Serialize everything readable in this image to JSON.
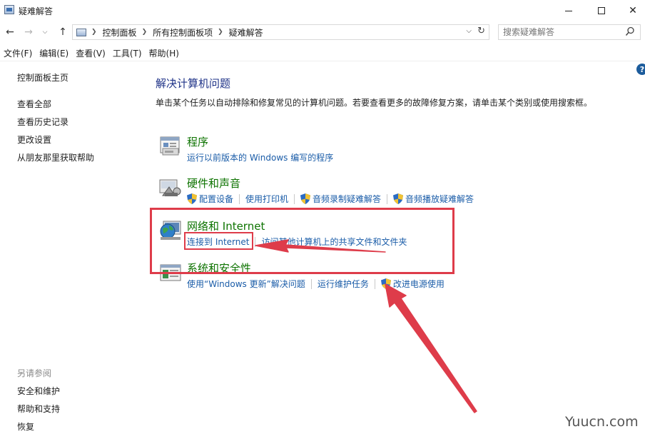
{
  "window": {
    "title": "疑难解答"
  },
  "address": {
    "crumbs": [
      "控制面板",
      "所有控制面板项",
      "疑难解答"
    ],
    "search_placeholder": "搜索疑难解答"
  },
  "menu": [
    "文件(F)",
    "编辑(E)",
    "查看(V)",
    "工具(T)",
    "帮助(H)"
  ],
  "sidebar": {
    "home": "控制面板主页",
    "links": [
      "查看全部",
      "查看历史记录",
      "更改设置",
      "从朋友那里获取帮助"
    ],
    "see_also_title": "另请参阅",
    "see_also": [
      "安全和维护",
      "帮助和支持",
      "恢复"
    ]
  },
  "main": {
    "title": "解决计算机问题",
    "description": "单击某个任务以自动排除和修复常见的计算机问题。若要查看更多的故障修复方案，请单击某个类别或使用搜索框。",
    "categories": [
      {
        "title": "程序",
        "icon": "programs-icon",
        "links": [
          {
            "label": "运行以前版本的 Windows 编写的程序",
            "shield": false
          }
        ]
      },
      {
        "title": "硬件和声音",
        "icon": "hardware-sound-icon",
        "links": [
          {
            "label": "配置设备",
            "shield": true
          },
          {
            "label": "使用打印机",
            "shield": false
          },
          {
            "label": "音频录制疑难解答",
            "shield": true
          },
          {
            "label": "音频播放疑难解答",
            "shield": true
          }
        ]
      },
      {
        "title": "网络和 Internet",
        "icon": "network-internet-icon",
        "links": [
          {
            "label": "连接到 Internet",
            "shield": false
          },
          {
            "label": "访问其他计算机上的共享文件和文件夹",
            "shield": false
          }
        ]
      },
      {
        "title": "系统和安全性",
        "icon": "system-security-icon",
        "links": [
          {
            "label": "使用“Windows 更新”解决问题",
            "shield": false
          },
          {
            "label": "运行维护任务",
            "shield": false
          },
          {
            "label": "改进电源使用",
            "shield": true
          }
        ]
      }
    ]
  },
  "watermark": "Yuucn.com",
  "colors": {
    "link": "#1a5ca8",
    "category_title": "#0d7300",
    "heading": "#1e3287",
    "annotation": "#de3c4a"
  }
}
